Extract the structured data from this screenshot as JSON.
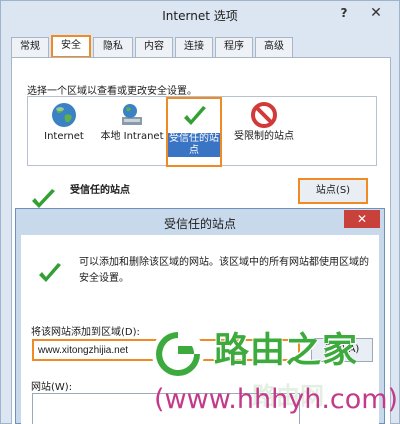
{
  "outer": {
    "title": "Internet 选项",
    "help_glyph": "?",
    "close_glyph": "✕",
    "tabs": [
      "常规",
      "安全",
      "隐私",
      "内容",
      "连接",
      "程序",
      "高级"
    ],
    "active_tab": "安全",
    "zone_instruction": "选择一个区域以查看或更改安全设置。",
    "zones": [
      {
        "label": "Internet",
        "icon": "globe-icon"
      },
      {
        "label": "本地 Intranet",
        "icon": "intranet-icon"
      },
      {
        "label": "受信任的站点",
        "icon": "green-check-icon",
        "selected": true
      },
      {
        "label": "受限制的站点",
        "icon": "no-entry-icon"
      }
    ],
    "trusted_heading": "受信任的站点",
    "sites_button": "站点(S)"
  },
  "inner": {
    "title": "受信任的站点",
    "close_glyph": "✕",
    "description": "可以添加和删除该区域的网站。该区域中的所有网站都使用区域的安全设置。",
    "add_label": "将该网站添加到区域(D):",
    "url_value": "www.xitongzhijia.net",
    "add_button": "添加(A)",
    "websites_label": "网站(W):"
  },
  "watermark": {
    "brand_text": "路由之家",
    "ghost_text": "路由网",
    "url_text": "(www.hhhyh.com)"
  },
  "colors": {
    "highlight": "#f08a24",
    "selection": "#3a74c4",
    "brand_green": "#3daa3d",
    "brand_magenta": "#c43a8a",
    "close_red": "#c8413b"
  }
}
